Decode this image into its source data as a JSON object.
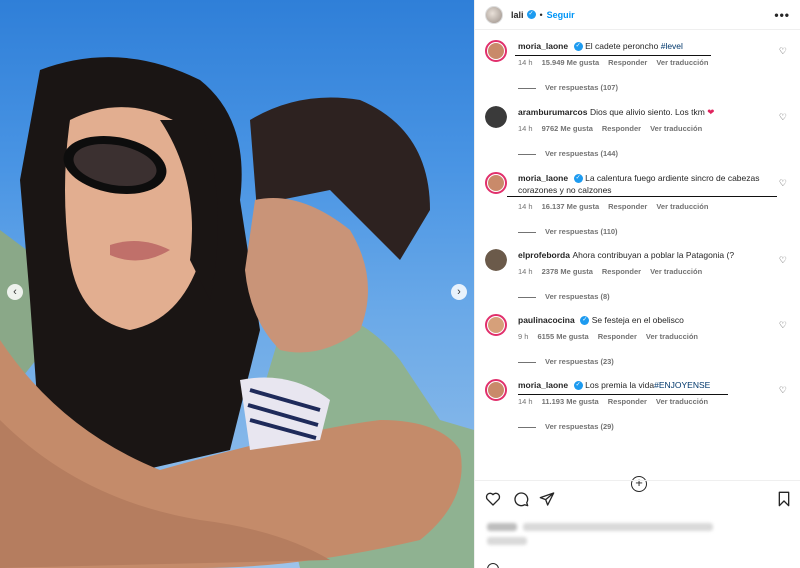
{
  "post": {
    "author": "lali",
    "follow_label": "Seguir",
    "more_label": "•••",
    "carousel_prev": "‹",
    "carousel_next": "›"
  },
  "comments": [
    {
      "user": "moria_laone",
      "verified": true,
      "text": "El cadete peroncho ",
      "hashtag": "#level",
      "time": "14 h",
      "likes": "15.949 Me gusta",
      "reply": "Responder",
      "translate": "Ver traducción",
      "replies": "Ver respuestas (107)",
      "avatar_color": "#c98a6a"
    },
    {
      "user": "aramburumarcos",
      "verified": false,
      "text": "Dios que alivio siento. Los tkm",
      "emoji": "❤",
      "time": "14 h",
      "likes": "9762 Me gusta",
      "reply": "Responder",
      "translate": "Ver traducción",
      "replies": "Ver respuestas (144)",
      "avatar_color": "#3a3a3a"
    },
    {
      "user": "moria_laone",
      "verified": true,
      "text": "La calentura fuego ardiente sincro de cabezas corazones y no calzones",
      "time": "14 h",
      "likes": "16.137 Me gusta",
      "reply": "Responder",
      "translate": "Ver traducción",
      "replies": "Ver respuestas (110)",
      "avatar_color": "#c98a6a"
    },
    {
      "user": "elprofeborda",
      "verified": false,
      "text": "Ahora contribuyan a poblar la Patagonia (?",
      "time": "14 h",
      "likes": "2378 Me gusta",
      "reply": "Responder",
      "translate": "Ver traducción",
      "replies": "Ver respuestas (8)",
      "avatar_color": "#6b5a4a"
    },
    {
      "user": "paulinacocina",
      "verified": true,
      "text": "Se festeja en el obelisco",
      "time": "9 h",
      "likes": "6155 Me gusta",
      "reply": "Responder",
      "translate": "Ver traducción",
      "replies": "Ver respuestas (23)",
      "avatar_color": "#d6a07a"
    },
    {
      "user": "moria_laone",
      "verified": true,
      "text": "Los premia la vida",
      "hashtag": "#ENJOYENSE",
      "time": "14 h",
      "likes": "11.193 Me gusta",
      "reply": "Responder",
      "translate": "Ver traducción",
      "replies": "Ver respuestas (29)",
      "avatar_color": "#c98a6a"
    }
  ],
  "icons": {
    "like": "heart-icon",
    "comment": "comment-icon",
    "share": "paper-plane-icon",
    "save": "bookmark-icon",
    "load_more": "plus-circle-icon"
  },
  "colors": {
    "link": "#0095f6",
    "hashtag": "#00376b",
    "verified": "#1d9bf0",
    "story_ring": "#e1306c"
  }
}
